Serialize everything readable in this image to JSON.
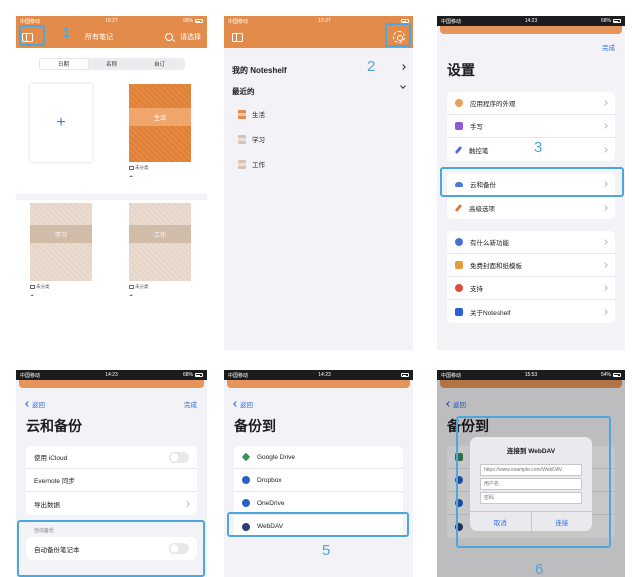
{
  "status": {
    "carrier": "中国移动",
    "p1_time": "15:27",
    "p1_battery": "58%",
    "p2_time": "15:27",
    "p3_time": "14:23",
    "p3_battery": "68%",
    "p4_time": "14:23",
    "p4_battery": "68%",
    "p5_time": "14:23",
    "p6_time": "15:53",
    "p6_battery": "54%"
  },
  "panel1": {
    "nav_title": "所有笔记",
    "select_label": "请选择",
    "segments": [
      "日期",
      "名称",
      "自订"
    ],
    "add_symbol": "+",
    "notebooks": [
      {
        "title": "生活",
        "folder": "未分类"
      },
      {
        "title": "学习",
        "folder": "未分类"
      },
      {
        "title": "工作",
        "folder": "未分类"
      }
    ]
  },
  "panel2": {
    "my_noteshelf": "我的 Noteshelf",
    "recent": "最近的",
    "recent_items": [
      "生活",
      "学习",
      "工作"
    ]
  },
  "panel3": {
    "done": "完成",
    "title": "设置",
    "group1": [
      "应用程序的外观",
      "手写",
      "触控笔"
    ],
    "group2": [
      "云和备份",
      "高级选项"
    ],
    "group3": [
      "有什么新功能",
      "免费封面和纸模板",
      "支持",
      "关于Noteshelf"
    ]
  },
  "panel4": {
    "back": "返回",
    "done": "完成",
    "title": "云和备份",
    "rows": [
      "使用 iCloud",
      "Evernote 同步",
      "导出数据"
    ],
    "section_label": "自动备份",
    "auto_backup_row": "自动备份笔记本"
  },
  "panel5": {
    "back": "返回",
    "title": "备份到",
    "services": [
      "Google Drive",
      "Dropbox",
      "OneDrive",
      "WebDAV"
    ]
  },
  "panel6": {
    "back": "返回",
    "title": "备份到",
    "dialog_title": "连接到 WebDAV",
    "url_placeholder": "https://www.example.com/WebDAV",
    "user_placeholder": "用户名",
    "password_placeholder": "密码",
    "cancel": "取消",
    "connect": "连接"
  },
  "steps": [
    "1",
    "2",
    "3",
    "5",
    "6"
  ],
  "colors": {
    "brand_orange": "#e38b4a",
    "annotation_blue": "#4ba8dd",
    "link_blue": "#2f6fe0"
  }
}
